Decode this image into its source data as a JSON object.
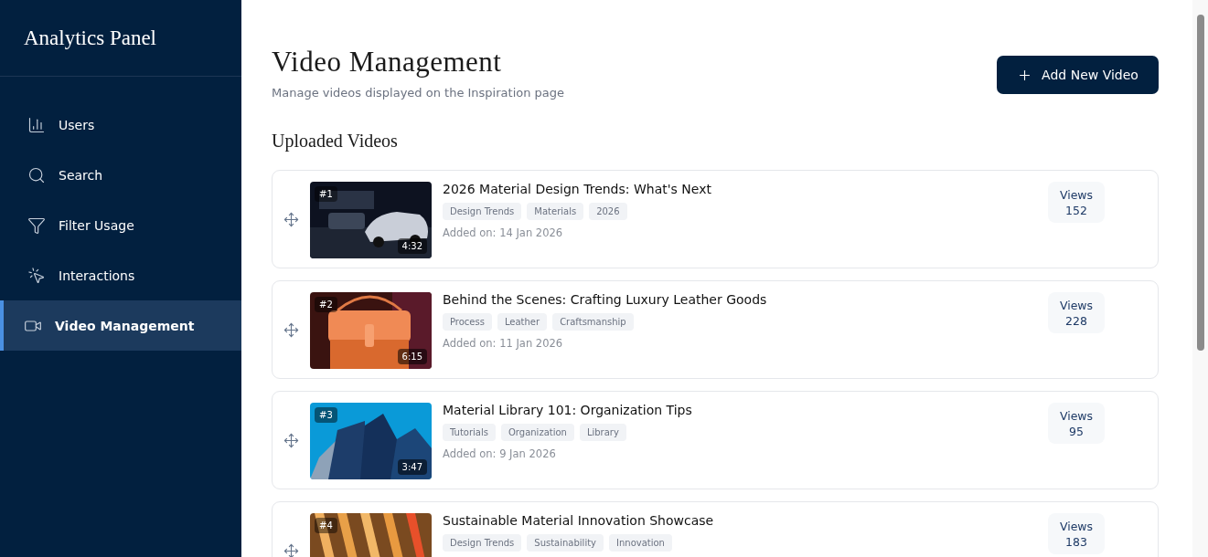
{
  "sidebar": {
    "title": "Analytics Panel",
    "items": [
      {
        "label": "Users",
        "kind": "chart",
        "selected": false
      },
      {
        "label": "Search",
        "kind": "search",
        "selected": false
      },
      {
        "label": "Filter Usage",
        "kind": "filter",
        "selected": false
      },
      {
        "label": "Interactions",
        "kind": "pointer",
        "selected": false
      },
      {
        "label": "Video Management",
        "kind": "video",
        "selected": true
      }
    ]
  },
  "header": {
    "title": "Video Management",
    "subtitle": "Manage videos displayed on the Inspiration page",
    "add_button": "Add New Video"
  },
  "section_title": "Uploaded Videos",
  "videos": [
    {
      "rank": "#1",
      "duration": "4:32",
      "title": "2026 Material Design Trends: What's Next",
      "tags": [
        "Design Trends",
        "Materials",
        "2026"
      ],
      "added": "Added on: 14 Jan 2026",
      "views_label": "Views",
      "views": "152",
      "thumbnail": {
        "kind": "picture"
      }
    },
    {
      "rank": "#2",
      "duration": "6:15",
      "title": "Behind the Scenes: Crafting Luxury Leather Goods",
      "tags": [
        "Process",
        "Leather",
        "Craftsmanship"
      ],
      "added": "Added on: 11 Jan 2026",
      "views_label": "Views",
      "views": "228",
      "thumbnail": {
        "kind": "picture"
      }
    },
    {
      "rank": "#3",
      "duration": "3:47",
      "title": "Material Library 101: Organization Tips",
      "tags": [
        "Tutorials",
        "Organization",
        "Library"
      ],
      "added": "Added on: 9 Jan 2026",
      "views_label": "Views",
      "views": "95",
      "thumbnail": {
        "kind": "picture"
      }
    },
    {
      "rank": "#4",
      "title": "Sustainable Material Innovation Showcase",
      "tags": [
        "Design Trends",
        "Sustainability",
        "Innovation"
      ],
      "views_label": "Views",
      "views": "183",
      "thumbnail": {
        "kind": "picture"
      }
    }
  ]
}
